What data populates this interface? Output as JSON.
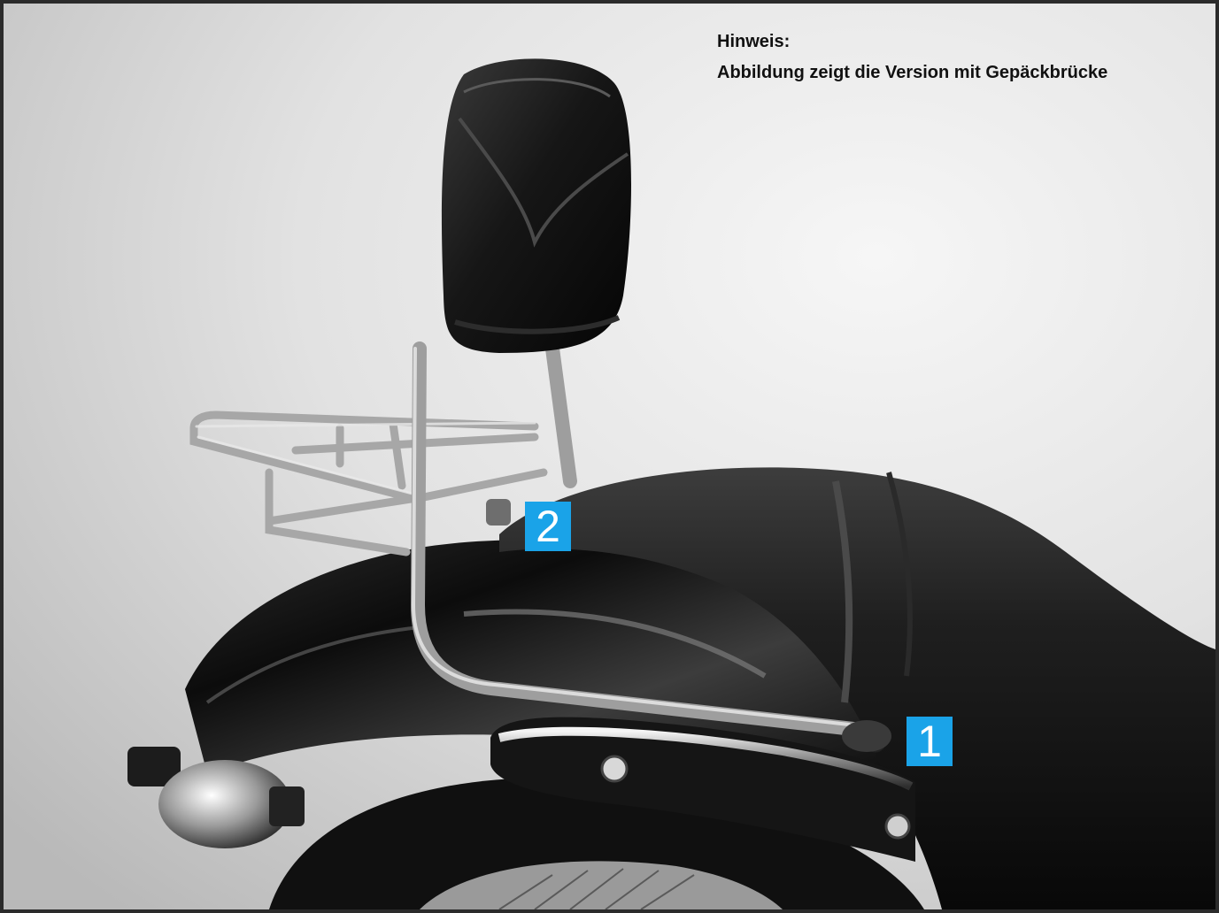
{
  "note": {
    "heading": "Hinweis:",
    "text": "Abbildung zeigt die Version mit Gepäckbrücke"
  },
  "markers": {
    "one": "1",
    "two": "2"
  },
  "colors": {
    "marker_bg": "#1aa3e8",
    "frame_border": "#2b2b2b"
  }
}
